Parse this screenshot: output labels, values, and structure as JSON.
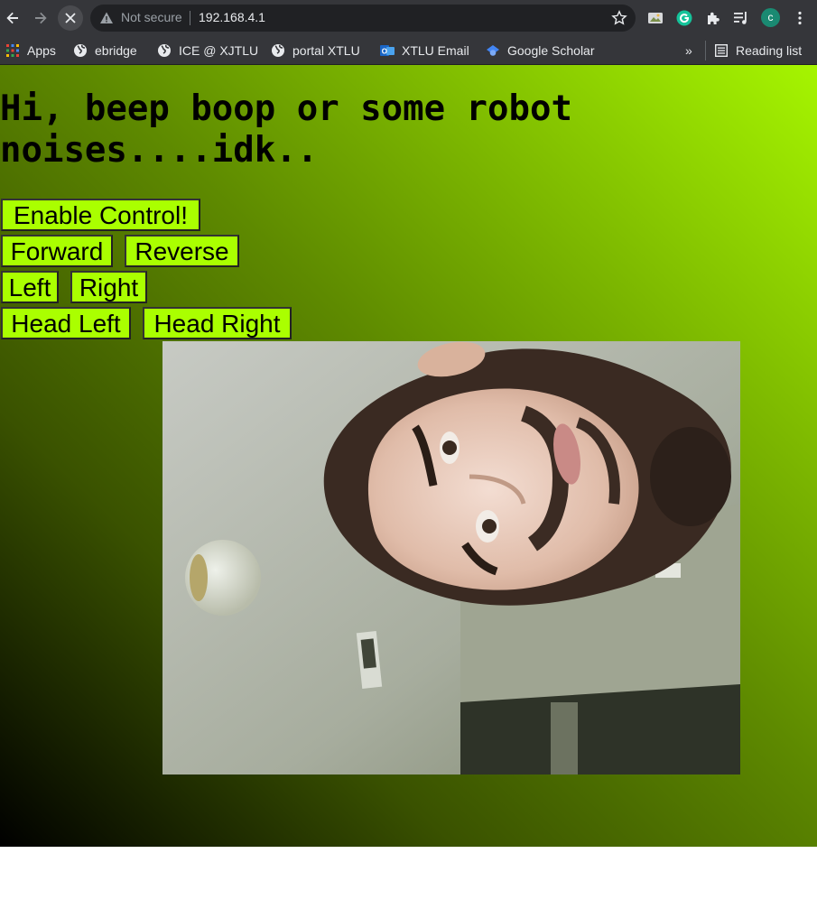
{
  "browser": {
    "security_label": "Not secure",
    "url": "192.168.4.1",
    "profile_initial": "c",
    "icons": [
      "back-icon",
      "forward-icon",
      "stop-loading-icon",
      "warning-icon",
      "star-icon",
      "extension-icon",
      "grammarly-icon",
      "puzzle-icon",
      "media-queue-icon",
      "kebab-menu-icon"
    ]
  },
  "bookmarks": {
    "items": [
      {
        "label": "Apps",
        "icon": "apps-grid-icon"
      },
      {
        "label": "ebridge",
        "icon": "globe-icon"
      },
      {
        "label": "ICE @ XJTLU",
        "icon": "globe-icon"
      },
      {
        "label": "portal XTLU",
        "icon": "globe-icon"
      },
      {
        "label": "XTLU Email",
        "icon": "outlook-icon"
      },
      {
        "label": "Google Scholar",
        "icon": "scholar-cap-icon"
      }
    ],
    "overflow": "»",
    "reading_list": "Reading list"
  },
  "page": {
    "title": "Hi, beep boop or some robot noises....idk..",
    "buttons": {
      "enable": "Enable Control!",
      "forward": "Forward",
      "reverse": "Reverse",
      "left": "Left",
      "right": "Right",
      "head_left": "Head Left",
      "head_right": "Head Right"
    },
    "background_colors": [
      "#000000",
      "#5e8a00",
      "#a6f500"
    ],
    "button_color": "#aaff00"
  }
}
